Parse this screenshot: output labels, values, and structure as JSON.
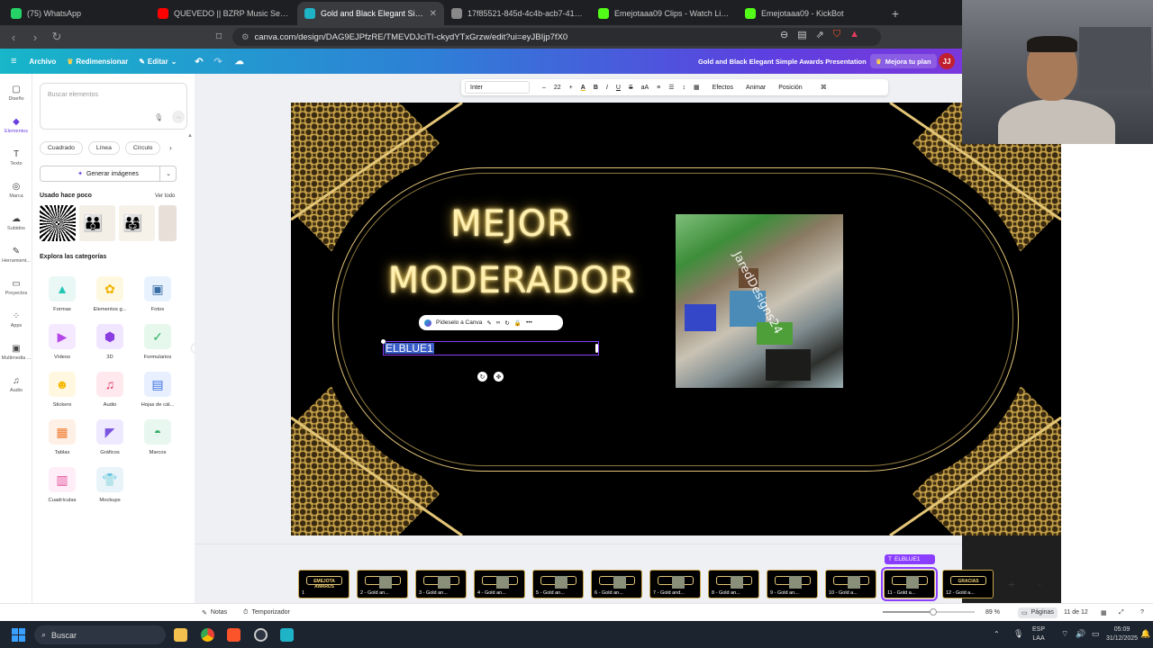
{
  "browser": {
    "tabs": [
      {
        "title": "(75) WhatsApp",
        "color": "#25d366",
        "active": false
      },
      {
        "title": "QUEVEDO || BZRP Music Sessions #5",
        "color": "#ff0000",
        "active": false
      },
      {
        "title": "Gold and Black Elegant Simple A",
        "color": "#1fb3c8",
        "active": true
      },
      {
        "title": "17f85521-845d-4c4b-acb7-41009dd",
        "color": "#888888",
        "active": false
      },
      {
        "title": "Emejotaaa09 Clips - Watch Live o",
        "color": "#53fc18",
        "active": false
      },
      {
        "title": "Emejotaaa09 - KickBot",
        "color": "#53fc18",
        "active": false
      }
    ],
    "new_tab": "+",
    "url": "canva.com/design/DAG9EJPfzRE/TMEVDJciTI-ckydYTxGrzw/edit?ui=eyJBIjp7fX0"
  },
  "canva_header": {
    "menu": "≡",
    "archivo": "Archivo",
    "redimensionar": "Redimensionar",
    "editar": "Editar",
    "doc_title": "Gold and Black Elegant Simple Awards Presentation",
    "upgrade": "Mejora tu plan",
    "avatar": "JJ"
  },
  "rail": [
    {
      "label": "Diseño",
      "icon": "layout-icon",
      "glyph": "▢"
    },
    {
      "label": "Elementos",
      "icon": "elements-icon",
      "glyph": "◆",
      "selected": true
    },
    {
      "label": "Texto",
      "icon": "text-icon",
      "glyph": "T"
    },
    {
      "label": "Marca",
      "icon": "brand-icon",
      "glyph": "◎"
    },
    {
      "label": "Subidos",
      "icon": "upload-icon",
      "glyph": "☁"
    },
    {
      "label": "Herramient...",
      "icon": "tools-icon",
      "glyph": "✎"
    },
    {
      "label": "Proyectos",
      "icon": "folder-icon",
      "glyph": "▭"
    },
    {
      "label": "Apps",
      "icon": "apps-icon",
      "glyph": "⁘"
    },
    {
      "label": "Multimedia ...",
      "icon": "media-icon",
      "glyph": "▣"
    },
    {
      "label": "Audio",
      "icon": "music-icon",
      "glyph": "♫"
    }
  ],
  "panel": {
    "search_placeholder": "Buscar elementos",
    "chips": [
      "Cuadrado",
      "Línea",
      "Círculo"
    ],
    "generate": "Generar imágenes",
    "recent_title": "Usado hace poco",
    "see_all": "Ver todo",
    "explore_title": "Explora las categorías",
    "categories": [
      {
        "label": "Formas",
        "color": "#e9f7f5",
        "glyph": "▲",
        "gcolor": "#26c6b6"
      },
      {
        "label": "Elementos g...",
        "color": "#fff8e1",
        "glyph": "✿",
        "gcolor": "#f0b400"
      },
      {
        "label": "Fotos",
        "color": "#e8f2ff",
        "glyph": "▣",
        "gcolor": "#3a6ea5"
      },
      {
        "label": "Vídeos",
        "color": "#f5e9ff",
        "glyph": "▶",
        "gcolor": "#b547e8"
      },
      {
        "label": "3D",
        "color": "#f1e6ff",
        "glyph": "⬢",
        "gcolor": "#8a3de0"
      },
      {
        "label": "Formularios",
        "color": "#e6f7ec",
        "glyph": "✓",
        "gcolor": "#2ab35e"
      },
      {
        "label": "Stickers",
        "color": "#fff7e0",
        "glyph": "☻",
        "gcolor": "#f5b800"
      },
      {
        "label": "Audio",
        "color": "#ffe9ef",
        "glyph": "♫",
        "gcolor": "#e0305a"
      },
      {
        "label": "Hojas de cál...",
        "color": "#e8f0ff",
        "glyph": "▤",
        "gcolor": "#3c6fe0"
      },
      {
        "label": "Tablas",
        "color": "#fff0e6",
        "glyph": "▦",
        "gcolor": "#ef7b2f"
      },
      {
        "label": "Gráficos",
        "color": "#efe9ff",
        "glyph": "◤",
        "gcolor": "#7a56e0"
      },
      {
        "label": "Marcos",
        "color": "#e8f7ef",
        "glyph": "◓",
        "gcolor": "#3bb06b"
      },
      {
        "label": "Cuadrículas",
        "color": "#ffeef7",
        "glyph": "▥",
        "gcolor": "#e54d9c"
      },
      {
        "label": "Mockups",
        "color": "#e8f4f9",
        "glyph": "👕",
        "gcolor": "#4f8fa8"
      }
    ]
  },
  "toolbar": {
    "font": "Inter",
    "minus": "–",
    "size": "22",
    "plus": "+",
    "items": [
      "B",
      "I",
      "U",
      "S",
      "aA"
    ],
    "efectos": "Efectos",
    "animar": "Animar",
    "posicion": "Posición"
  },
  "slide": {
    "title_line1": "MEJOR",
    "title_line2": "MODERADOR",
    "watermark": "JaredDesigns24",
    "selected_text": "ELBLUE1",
    "ctx_ask": "Pídeselo a Canva"
  },
  "filmstrip": {
    "selection_tag": "ELBLUE1",
    "pages": [
      {
        "label": "1",
        "text": "EMEJOTA AWARDS"
      },
      {
        "label": "2 - Gold an..."
      },
      {
        "label": "3 - Gold an..."
      },
      {
        "label": "4 - Gold an..."
      },
      {
        "label": "5 - Gold an..."
      },
      {
        "label": "6 - Gold an..."
      },
      {
        "label": "7 - Gold and..."
      },
      {
        "label": "8 - Gold an..."
      },
      {
        "label": "9 - Gold an..."
      },
      {
        "label": "10 - Gold a..."
      },
      {
        "label": "11 - Gold a...",
        "selected": true
      },
      {
        "label": "12 - Gold a...",
        "text": "GRACIAS"
      }
    ]
  },
  "status": {
    "notes": "Notas",
    "timer": "Temporizador",
    "zoom": "89 %",
    "zoom_value": 0.55,
    "pages_btn": "Páginas",
    "page_count": "11 de 12"
  },
  "taskbar": {
    "search": "Buscar",
    "lang1": "ESP",
    "lang2": "LAA",
    "time": "05:09",
    "date": "31/12/2025"
  }
}
